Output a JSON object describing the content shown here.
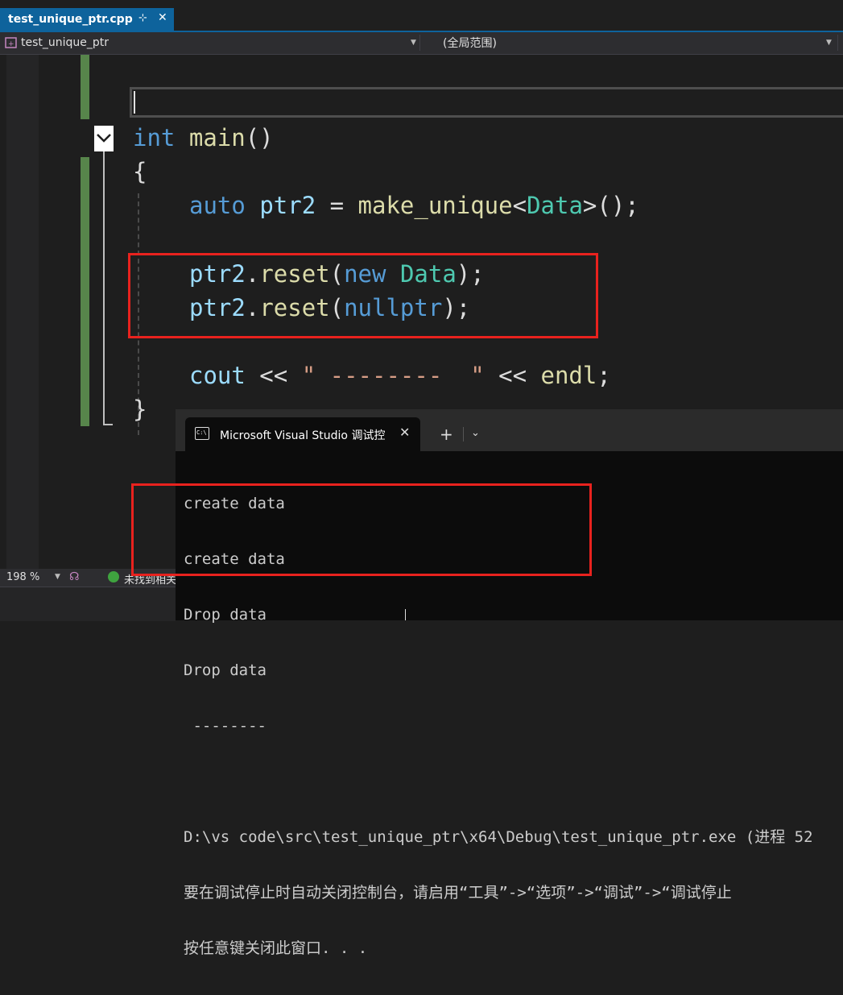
{
  "editor_tab": {
    "title": "test_unique_ptr.cpp",
    "pin_icon": "pin-icon",
    "close_icon": "close-icon"
  },
  "navbar": {
    "scope_left": "test_unique_ptr",
    "scope_right": "(全局范围)"
  },
  "code": {
    "line1": {
      "kw": "int",
      "fn": "main",
      "rest": "()"
    },
    "open_brace": "{",
    "line2": {
      "kw": "auto",
      "var": "ptr2",
      "eq": " = ",
      "fn": "make_unique",
      "lt": "<",
      "ty": "Data",
      "rest": ">();"
    },
    "line3": {
      "var": "ptr2",
      "dot": ".",
      "fn": "reset",
      "paren": "(",
      "kw": "new",
      "ty": "Data",
      "rest": ");"
    },
    "line4": {
      "var": "ptr2",
      "dot": ".",
      "fn": "reset",
      "paren": "(",
      "kw": "nullptr",
      "rest": ");"
    },
    "line5": {
      "var": "cout",
      "op1": " << ",
      "str": "\" --------  \"",
      "op2": " << ",
      "fn": "endl",
      "rest": ";"
    },
    "close_brace": "}"
  },
  "statusbar": {
    "zoom": "198 %",
    "status_text": "未找到相关问题"
  },
  "terminal": {
    "tab_title": "Microsoft Visual Studio 调试控",
    "lines": [
      "create data",
      "create data",
      "Drop data",
      "Drop data",
      " --------",
      "",
      "D:\\vs code\\src\\test_unique_ptr\\x64\\Debug\\test_unique_ptr.exe (进程 52",
      "要在调试停止时自动关闭控制台，请启用“工具”->“选项”->“调试”->“调试停止",
      "按任意键关闭此窗口. . ."
    ]
  },
  "colors": {
    "accent": "#0e639c",
    "highlight_box": "#e8221e",
    "changed_bar": "#57854b"
  }
}
